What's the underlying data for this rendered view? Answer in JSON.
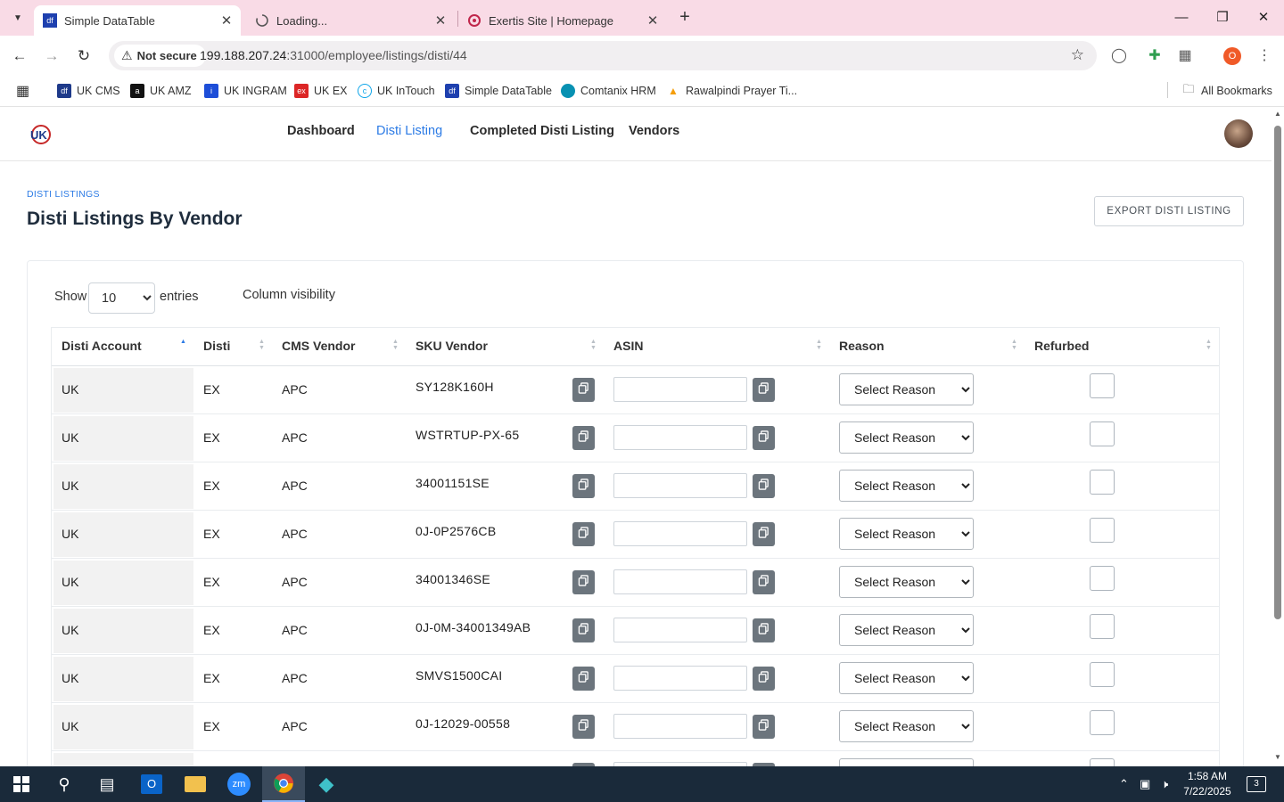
{
  "browser": {
    "tabs": [
      {
        "title": "Simple DataTable",
        "active": true
      },
      {
        "title": "Loading...",
        "active": false
      },
      {
        "title": "Exertis Site | Homepage",
        "active": false
      }
    ],
    "omnibox": {
      "security": "Not secure",
      "host": "199.188.207.24",
      "path": ":31000/employee/listings/disti/44"
    },
    "profile_initial": "O",
    "bookmarks": [
      {
        "label": "UK CMS",
        "color": "#1e3a8a"
      },
      {
        "label": "UK AMZ",
        "color": "#111111"
      },
      {
        "label": "UK INGRAM",
        "color": "#1d4ed8"
      },
      {
        "label": "UK EX",
        "color": "#dc2626"
      },
      {
        "label": "UK InTouch",
        "color": "#0ea5e9"
      },
      {
        "label": "Simple DataTable",
        "color": "#1e40af"
      },
      {
        "label": "Comtanix HRM",
        "color": "#0891b2"
      },
      {
        "label": "Rawalpindi Prayer Ti...",
        "color": "#f59e0b"
      }
    ],
    "all_bookmarks": "All Bookmarks"
  },
  "app": {
    "nav": [
      "Dashboard",
      "Disti Listing",
      "Completed Disti Listing",
      "Vendors"
    ],
    "active_nav": "Disti Listing",
    "accent": "#2c7be5"
  },
  "page": {
    "breadcrumb": "DISTI LISTINGS",
    "title": "Disti Listings By Vendor",
    "export_label": "EXPORT DISTI LISTING",
    "show_label": "Show",
    "entries_value": "10",
    "entries_label": "entries",
    "column_visibility": "Column visibility"
  },
  "table": {
    "columns": [
      "Disti Account",
      "Disti",
      "CMS Vendor",
      "SKU Vendor",
      "ASIN",
      "Reason",
      "Refurbed"
    ],
    "reason_placeholder": "Select Reason",
    "rows": [
      {
        "account": "UK",
        "disti": "EX",
        "vendor": "APC",
        "sku": "SY128K160H",
        "asin": ""
      },
      {
        "account": "UK",
        "disti": "EX",
        "vendor": "APC",
        "sku": "WSTRTUP-PX-65",
        "asin": ""
      },
      {
        "account": "UK",
        "disti": "EX",
        "vendor": "APC",
        "sku": "34001151SE",
        "asin": ""
      },
      {
        "account": "UK",
        "disti": "EX",
        "vendor": "APC",
        "sku": "0J-0P2576CB",
        "asin": ""
      },
      {
        "account": "UK",
        "disti": "EX",
        "vendor": "APC",
        "sku": "34001346SE",
        "asin": ""
      },
      {
        "account": "UK",
        "disti": "EX",
        "vendor": "APC",
        "sku": "0J-0M-34001349AB",
        "asin": ""
      },
      {
        "account": "UK",
        "disti": "EX",
        "vendor": "APC",
        "sku": "SMVS1500CAI",
        "asin": ""
      },
      {
        "account": "UK",
        "disti": "EX",
        "vendor": "APC",
        "sku": "0J-12029-00558",
        "asin": ""
      }
    ]
  },
  "taskbar": {
    "time": "1:58 AM",
    "date": "7/22/2025",
    "notifications": "3"
  }
}
